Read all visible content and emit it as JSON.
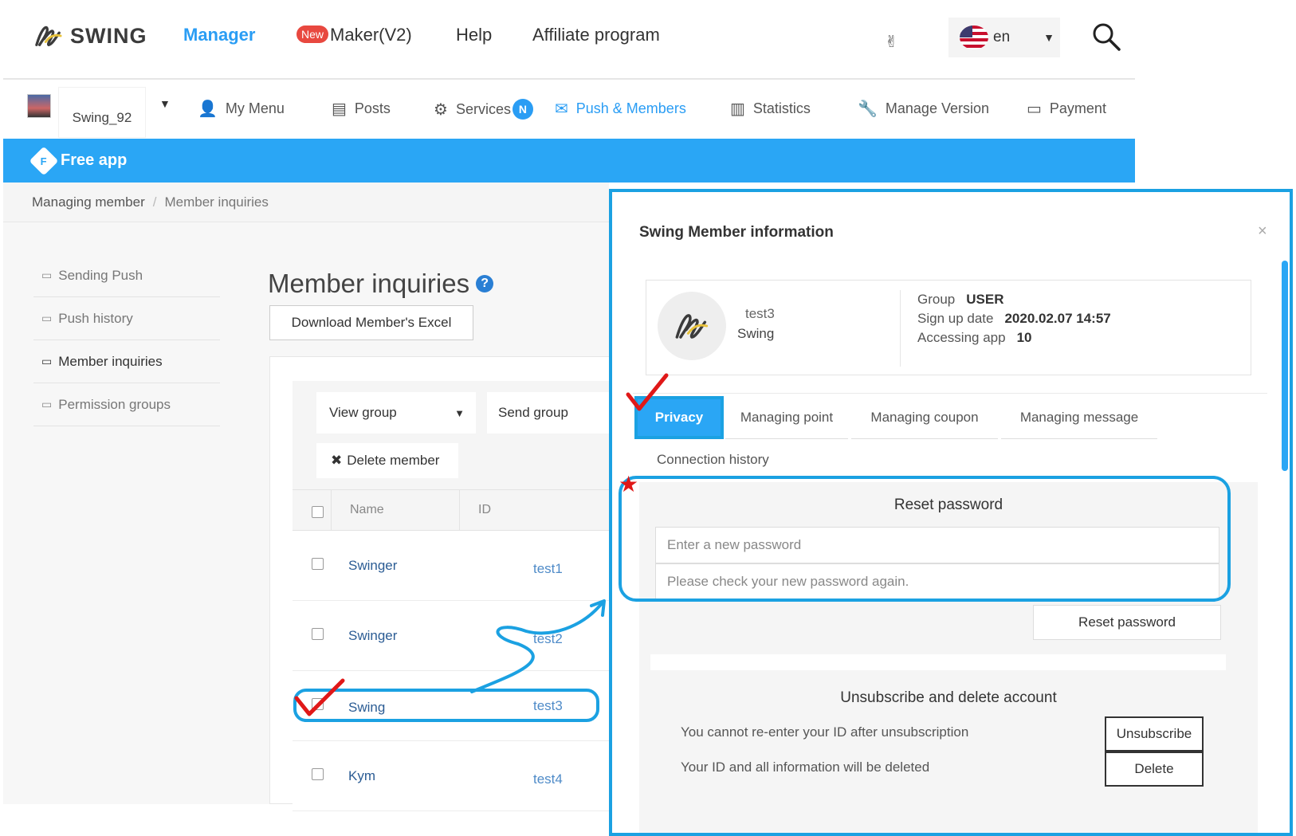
{
  "topnav": {
    "logo_text": "SWING",
    "links": [
      {
        "label": "Manager"
      },
      {
        "badge": "New",
        "label": "Maker(V2)"
      },
      {
        "label": "Help"
      },
      {
        "label": "Affiliate program"
      }
    ],
    "language": "en"
  },
  "subnav": {
    "app_name": "Swing_92",
    "items": [
      {
        "label": "My Menu",
        "icon": "user-icon"
      },
      {
        "label": "Posts",
        "icon": "posts-icon"
      },
      {
        "label": "Services",
        "icon": "gear-icon",
        "badge": "N"
      },
      {
        "label": "Push & Members",
        "icon": "envelope-icon"
      },
      {
        "label": "Statistics",
        "icon": "bar-chart-icon"
      },
      {
        "label": "Manage Version",
        "icon": "wrench-icon"
      },
      {
        "label": "Payment",
        "icon": "card-icon"
      }
    ]
  },
  "banner": {
    "label": "Free app",
    "icon_letter": "F"
  },
  "breadcrumb": {
    "parent": "Managing member",
    "current": "Member inquiries"
  },
  "sidebar": {
    "items": [
      {
        "label": "Sending Push"
      },
      {
        "label": "Push history"
      },
      {
        "label": "Member inquiries"
      },
      {
        "label": "Permission groups"
      }
    ]
  },
  "main": {
    "title": "Member inquiries",
    "excel_button": "Download Member's Excel",
    "view_group": "View group",
    "send_group": "Send group",
    "delete_button": "Delete member",
    "columns": [
      "Name",
      "ID"
    ],
    "rows": [
      {
        "name": "Swinger",
        "id": "test1"
      },
      {
        "name": "Swinger",
        "id": "test2"
      },
      {
        "name": "Swing",
        "id": "test3"
      },
      {
        "name": "Kym",
        "id": "test4"
      }
    ]
  },
  "modal": {
    "title": "Swing Member information",
    "close": "×",
    "member_id": "test3",
    "member_name": "Swing",
    "group_label": "Group",
    "group_value": "USER",
    "signup_label": "Sign up date",
    "signup_value": "2020.02.07 14:57",
    "access_label": "Accessing app",
    "access_value": "10",
    "tabs": [
      "Privacy",
      "Managing point",
      "Managing coupon",
      "Managing message",
      "Connection history"
    ],
    "reset": {
      "title": "Reset password",
      "new_placeholder": "Enter a new password",
      "confirm_placeholder": "Please check your new password again.",
      "button": "Reset password"
    },
    "unsubscribe": {
      "title": "Unsubscribe and delete account",
      "line1": "You cannot re-enter your ID after unsubscription",
      "line2": "Your ID and all information will be deleted",
      "unsubscribe_button": "Unsubscribe",
      "delete_button": "Delete"
    }
  },
  "colors": {
    "accent": "#2aa6f5",
    "annotation": "#1ba1e2",
    "mark": "#e01818"
  }
}
